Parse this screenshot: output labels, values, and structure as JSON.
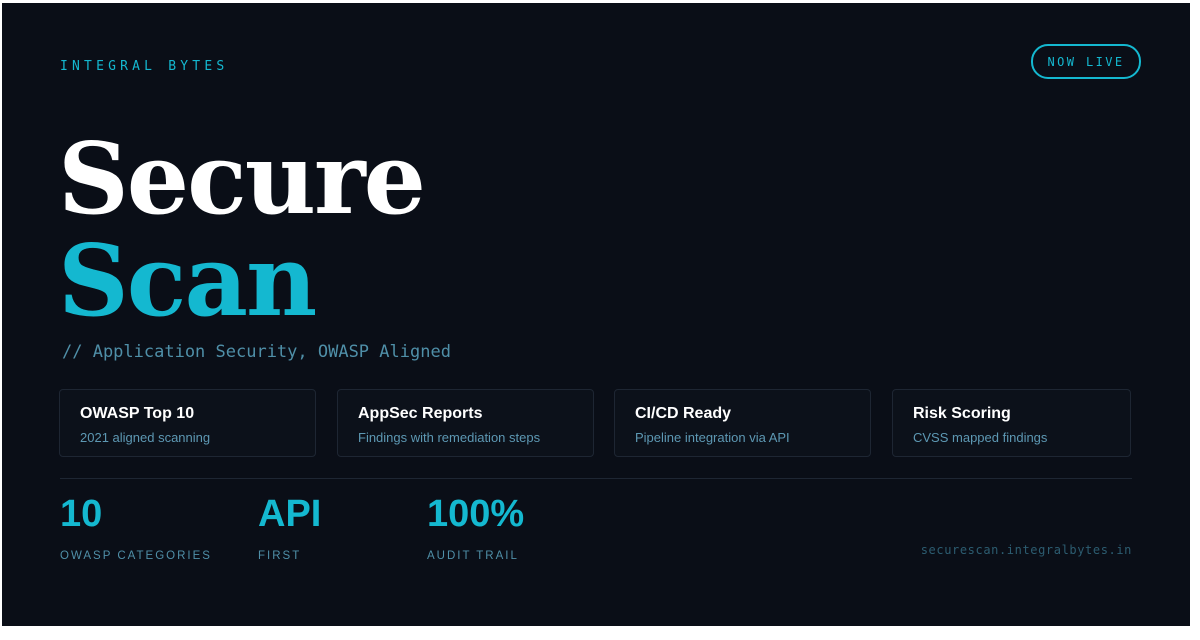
{
  "brand": "INTEGRAL BYTES",
  "badge": "NOW LIVE",
  "title": {
    "line1": "Secure",
    "line2": "Scan"
  },
  "subtitle": "// Application Security, OWASP Aligned",
  "features": [
    {
      "title": "OWASP Top 10",
      "subtitle": "2021 aligned scanning"
    },
    {
      "title": "AppSec Reports",
      "subtitle": "Findings with remediation steps"
    },
    {
      "title": "CI/CD Ready",
      "subtitle": "Pipeline integration via API"
    },
    {
      "title": "Risk Scoring",
      "subtitle": "CVSS mapped findings"
    }
  ],
  "stats": [
    {
      "value": "10",
      "label": "OWASP CATEGORIES"
    },
    {
      "value": "API",
      "label": "FIRST"
    },
    {
      "value": "100%",
      "label": "AUDIT TRAIL"
    }
  ],
  "url": "securescan.integralbytes.in",
  "colors": {
    "background": "#0a0e17",
    "accent": "#14b8d0",
    "text": "#ffffff",
    "muted": "#4f8fa8"
  }
}
